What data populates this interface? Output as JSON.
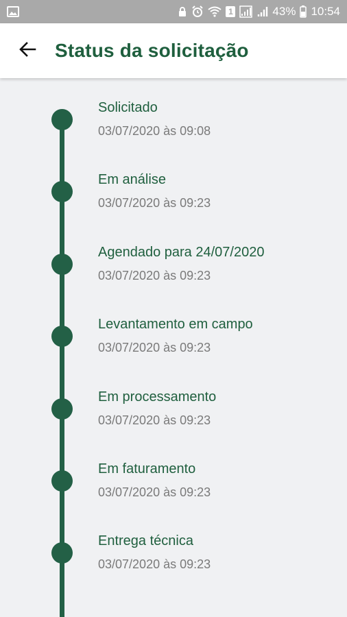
{
  "status_bar": {
    "battery": "43%",
    "time": "10:54",
    "sim": "1"
  },
  "header": {
    "title": "Status da solicitação",
    "back_icon": "arrow-left-icon"
  },
  "timeline": {
    "color": "#236046",
    "items": [
      {
        "title": "Solicitado",
        "date": "03/07/2020 às 09:08"
      },
      {
        "title": "Em análise",
        "date": "03/07/2020 às 09:23"
      },
      {
        "title": "Agendado para 24/07/2020",
        "date": "03/07/2020 às 09:23"
      },
      {
        "title": "Levantamento em campo",
        "date": "03/07/2020 às 09:23"
      },
      {
        "title": "Em processamento",
        "date": "03/07/2020 às 09:23"
      },
      {
        "title": "Em faturamento",
        "date": "03/07/2020 às 09:23"
      },
      {
        "title": "Entrega técnica",
        "date": "03/07/2020 às 09:23"
      }
    ]
  }
}
